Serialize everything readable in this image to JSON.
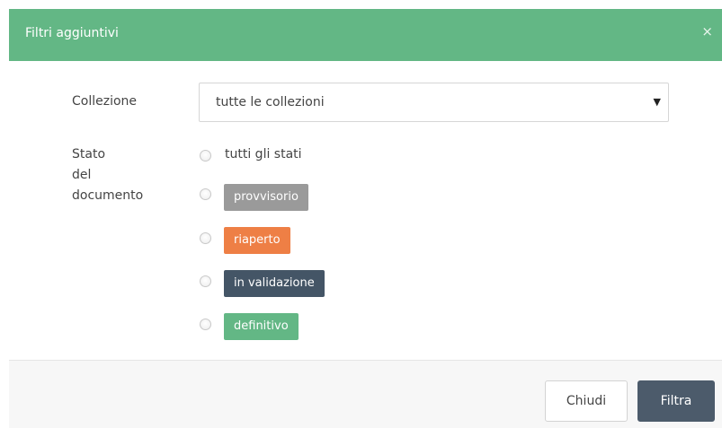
{
  "header": {
    "title": "Filtri aggiuntivi",
    "close_label": "×"
  },
  "collection": {
    "label": "Collezione",
    "selected": "tutte le collezioni",
    "chevron": "▼"
  },
  "status": {
    "label_line1": "Stato",
    "label_line2": "del",
    "label_line3": "documento",
    "options": [
      {
        "label": "tutti gli stati",
        "color": ""
      },
      {
        "label": "provvisorio",
        "color": "#9a9a9a"
      },
      {
        "label": "riaperto",
        "color": "#ee7f45"
      },
      {
        "label": "in validazione",
        "color": "#445566"
      },
      {
        "label": "definitivo",
        "color": "#63b785"
      }
    ]
  },
  "footer": {
    "close_button": "Chiudi",
    "filter_button": "Filtra"
  },
  "colors": {
    "header_bg": "#63b785",
    "primary_button": "#4c5b6b"
  }
}
